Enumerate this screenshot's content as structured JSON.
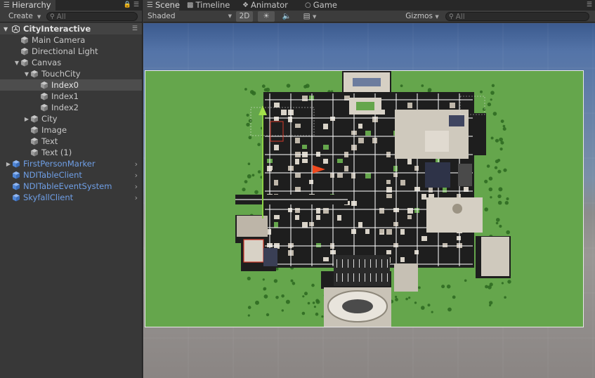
{
  "hierarchy_panel": {
    "tab_label": "Hierarchy",
    "create_label": "Create",
    "search_placeholder": "All",
    "scene_name": "CityInteractive",
    "items": [
      {
        "label": "Main Camera"
      },
      {
        "label": "Directional Light"
      },
      {
        "label": "Canvas"
      },
      {
        "label": "TouchCity"
      },
      {
        "label": "Index0"
      },
      {
        "label": "Index1"
      },
      {
        "label": "Index2"
      },
      {
        "label": "City"
      },
      {
        "label": "Image"
      },
      {
        "label": "Text"
      },
      {
        "label": "Text (1)"
      },
      {
        "label": "FirstPersonMarker"
      },
      {
        "label": "NDITableClient"
      },
      {
        "label": "NDITableEventSystem"
      },
      {
        "label": "SkyfallClient"
      }
    ]
  },
  "scene_panel": {
    "tabs": [
      {
        "label": "Scene"
      },
      {
        "label": "Timeline"
      },
      {
        "label": "Animator"
      },
      {
        "label": "Game"
      }
    ],
    "shading_mode": "Shaded",
    "toggle_2d": "2D",
    "gizmos_label": "Gizmos",
    "search_placeholder": "All"
  },
  "icons": {
    "scene_tab": "scene-tab-icon",
    "timeline_tab": "timeline-icon",
    "animator_tab": "animator-icon",
    "game_tab": "game-icon",
    "lighting": "sun-icon",
    "audio": "speaker-icon",
    "effects": "image-effects-icon",
    "lock": "lock-icon",
    "menu": "context-menu-icon",
    "search": "search-icon",
    "gameobject": "cube-icon",
    "prefab": "prefab-cube-icon",
    "scene_logo": "unity-logo-icon"
  },
  "colors": {
    "selection": "#4d4d4d",
    "prefab_text": "#6f9fe6",
    "board_green": "#65a64c",
    "gizmo_y": "#8cd246",
    "gizmo_x": "#f0491e"
  }
}
